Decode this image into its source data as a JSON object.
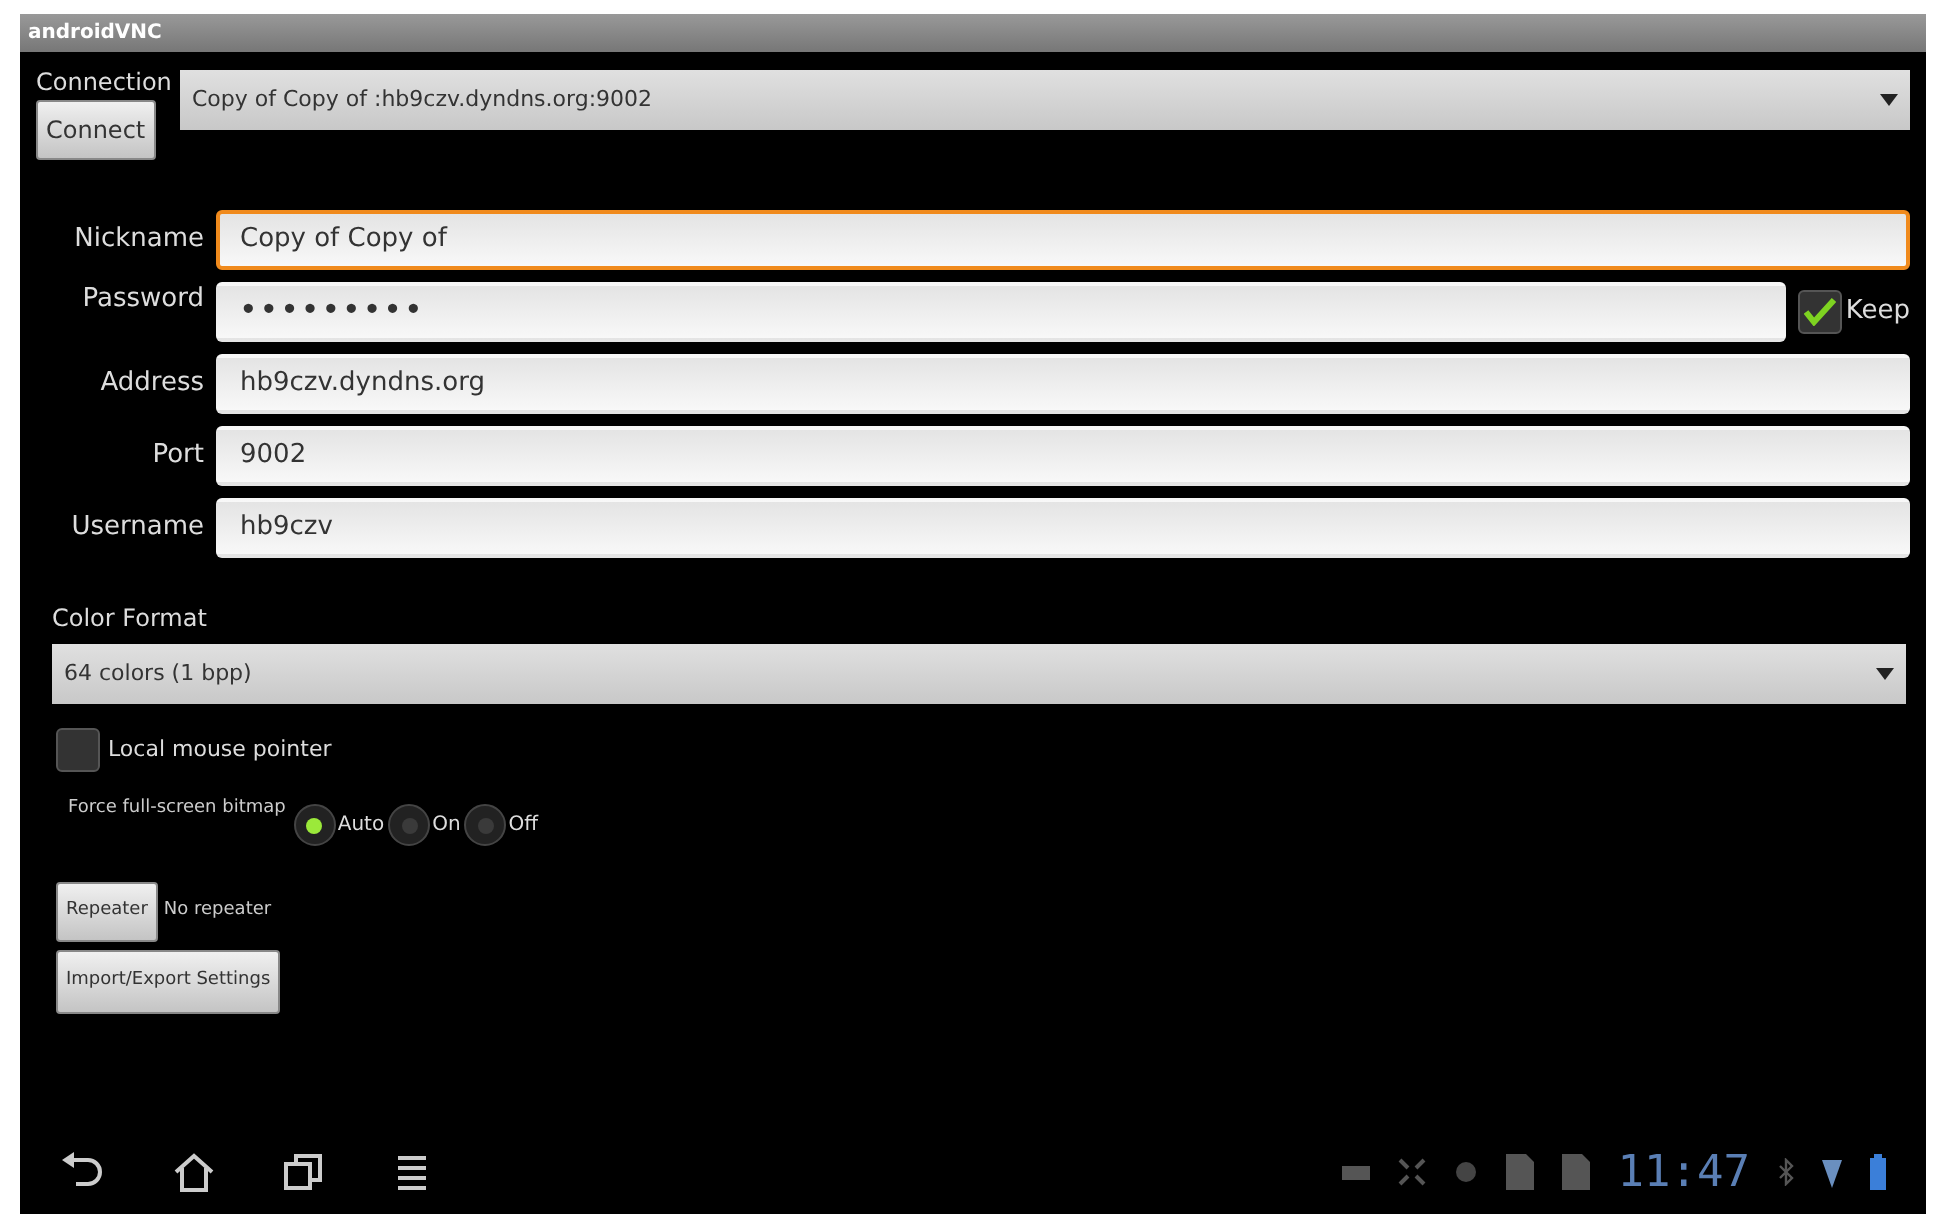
{
  "window": {
    "title": "androidVNC"
  },
  "connection": {
    "label": "Connection",
    "value": "Copy of Copy of :hb9czv.dyndns.org:9002",
    "button": "Connect"
  },
  "fields": [
    {
      "kind": "text",
      "label": "Nickname",
      "value": "Copy of Copy of",
      "focused": true
    },
    {
      "kind": "password",
      "label": "Password",
      "value": "•••••••••",
      "focused": false,
      "keep": {
        "label": "Keep",
        "checked": true
      }
    },
    {
      "kind": "text",
      "label": "Address",
      "value": "hb9czv.dyndns.org",
      "focused": false
    },
    {
      "kind": "text",
      "label": "Port",
      "value": "9002",
      "focused": false
    },
    {
      "kind": "text",
      "label": "Username",
      "value": "hb9czv",
      "focused": false
    }
  ],
  "color_format": {
    "label": "Color Format",
    "value": "64 colors (1 bpp)"
  },
  "local_mouse": {
    "label": "Local mouse pointer",
    "checked": false
  },
  "force_bitmap": {
    "label": "Force full-screen bitmap",
    "options": [
      {
        "label": "Auto",
        "selected": true
      },
      {
        "label": "On",
        "selected": false
      },
      {
        "label": "Off",
        "selected": false
      }
    ]
  },
  "repeater": {
    "button": "Repeater",
    "value": "No repeater"
  },
  "import_export": "Import/Export Settings",
  "status_bar": {
    "time": "11:47"
  }
}
